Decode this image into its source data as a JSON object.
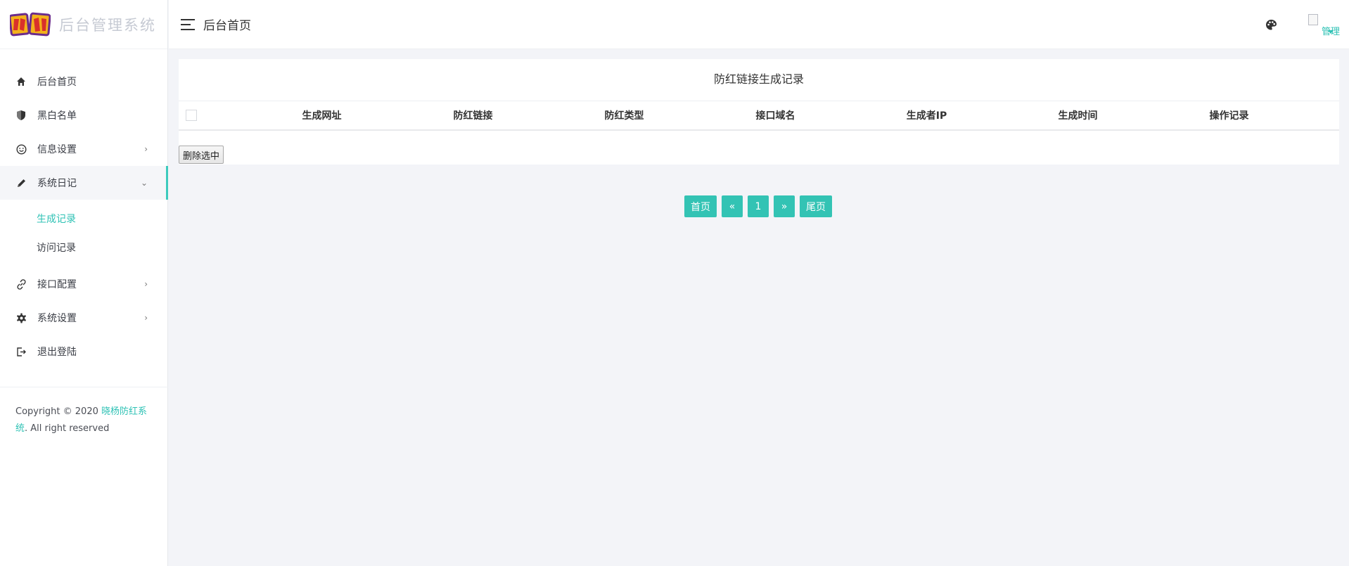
{
  "brand": {
    "logo_text": "防红",
    "system_name": "后台管理系统"
  },
  "sidebar": {
    "items": [
      {
        "label": "后台首页",
        "icon": "home-icon"
      },
      {
        "label": "黑白名单",
        "icon": "shield-icon"
      },
      {
        "label": "信息设置",
        "icon": "smile-icon",
        "arrow": "›"
      },
      {
        "label": "系统日记",
        "icon": "pencil-icon",
        "arrow": "⌄"
      },
      {
        "label": "接口配置",
        "icon": "link-icon",
        "arrow": "›"
      },
      {
        "label": "系统设置",
        "icon": "gear-icon",
        "arrow": "›"
      },
      {
        "label": "退出登陆",
        "icon": "logout-icon"
      }
    ],
    "submenu": [
      {
        "label": "生成记录",
        "active": true
      },
      {
        "label": "访问记录",
        "active": false
      }
    ],
    "copyright": {
      "prefix": "Copyright © 2020 ",
      "link": "晓杨防红系统",
      "suffix": ". All right reserved"
    }
  },
  "header": {
    "title": "后台首页",
    "user_name": "管理"
  },
  "panel": {
    "title": "防红链接生成记录",
    "columns": [
      "生成网址",
      "防红链接",
      "防红类型",
      "接口域名",
      "生成者IP",
      "生成时间",
      "操作记录"
    ],
    "delete_label": "删除选中"
  },
  "pagination": {
    "first": "首页",
    "prev": "«",
    "current": "1",
    "next": "»",
    "last": "尾页"
  },
  "colors": {
    "accent": "#33c3b4",
    "sidebar_bg": "#ffffff",
    "page_bg": "#f3f4f8"
  }
}
